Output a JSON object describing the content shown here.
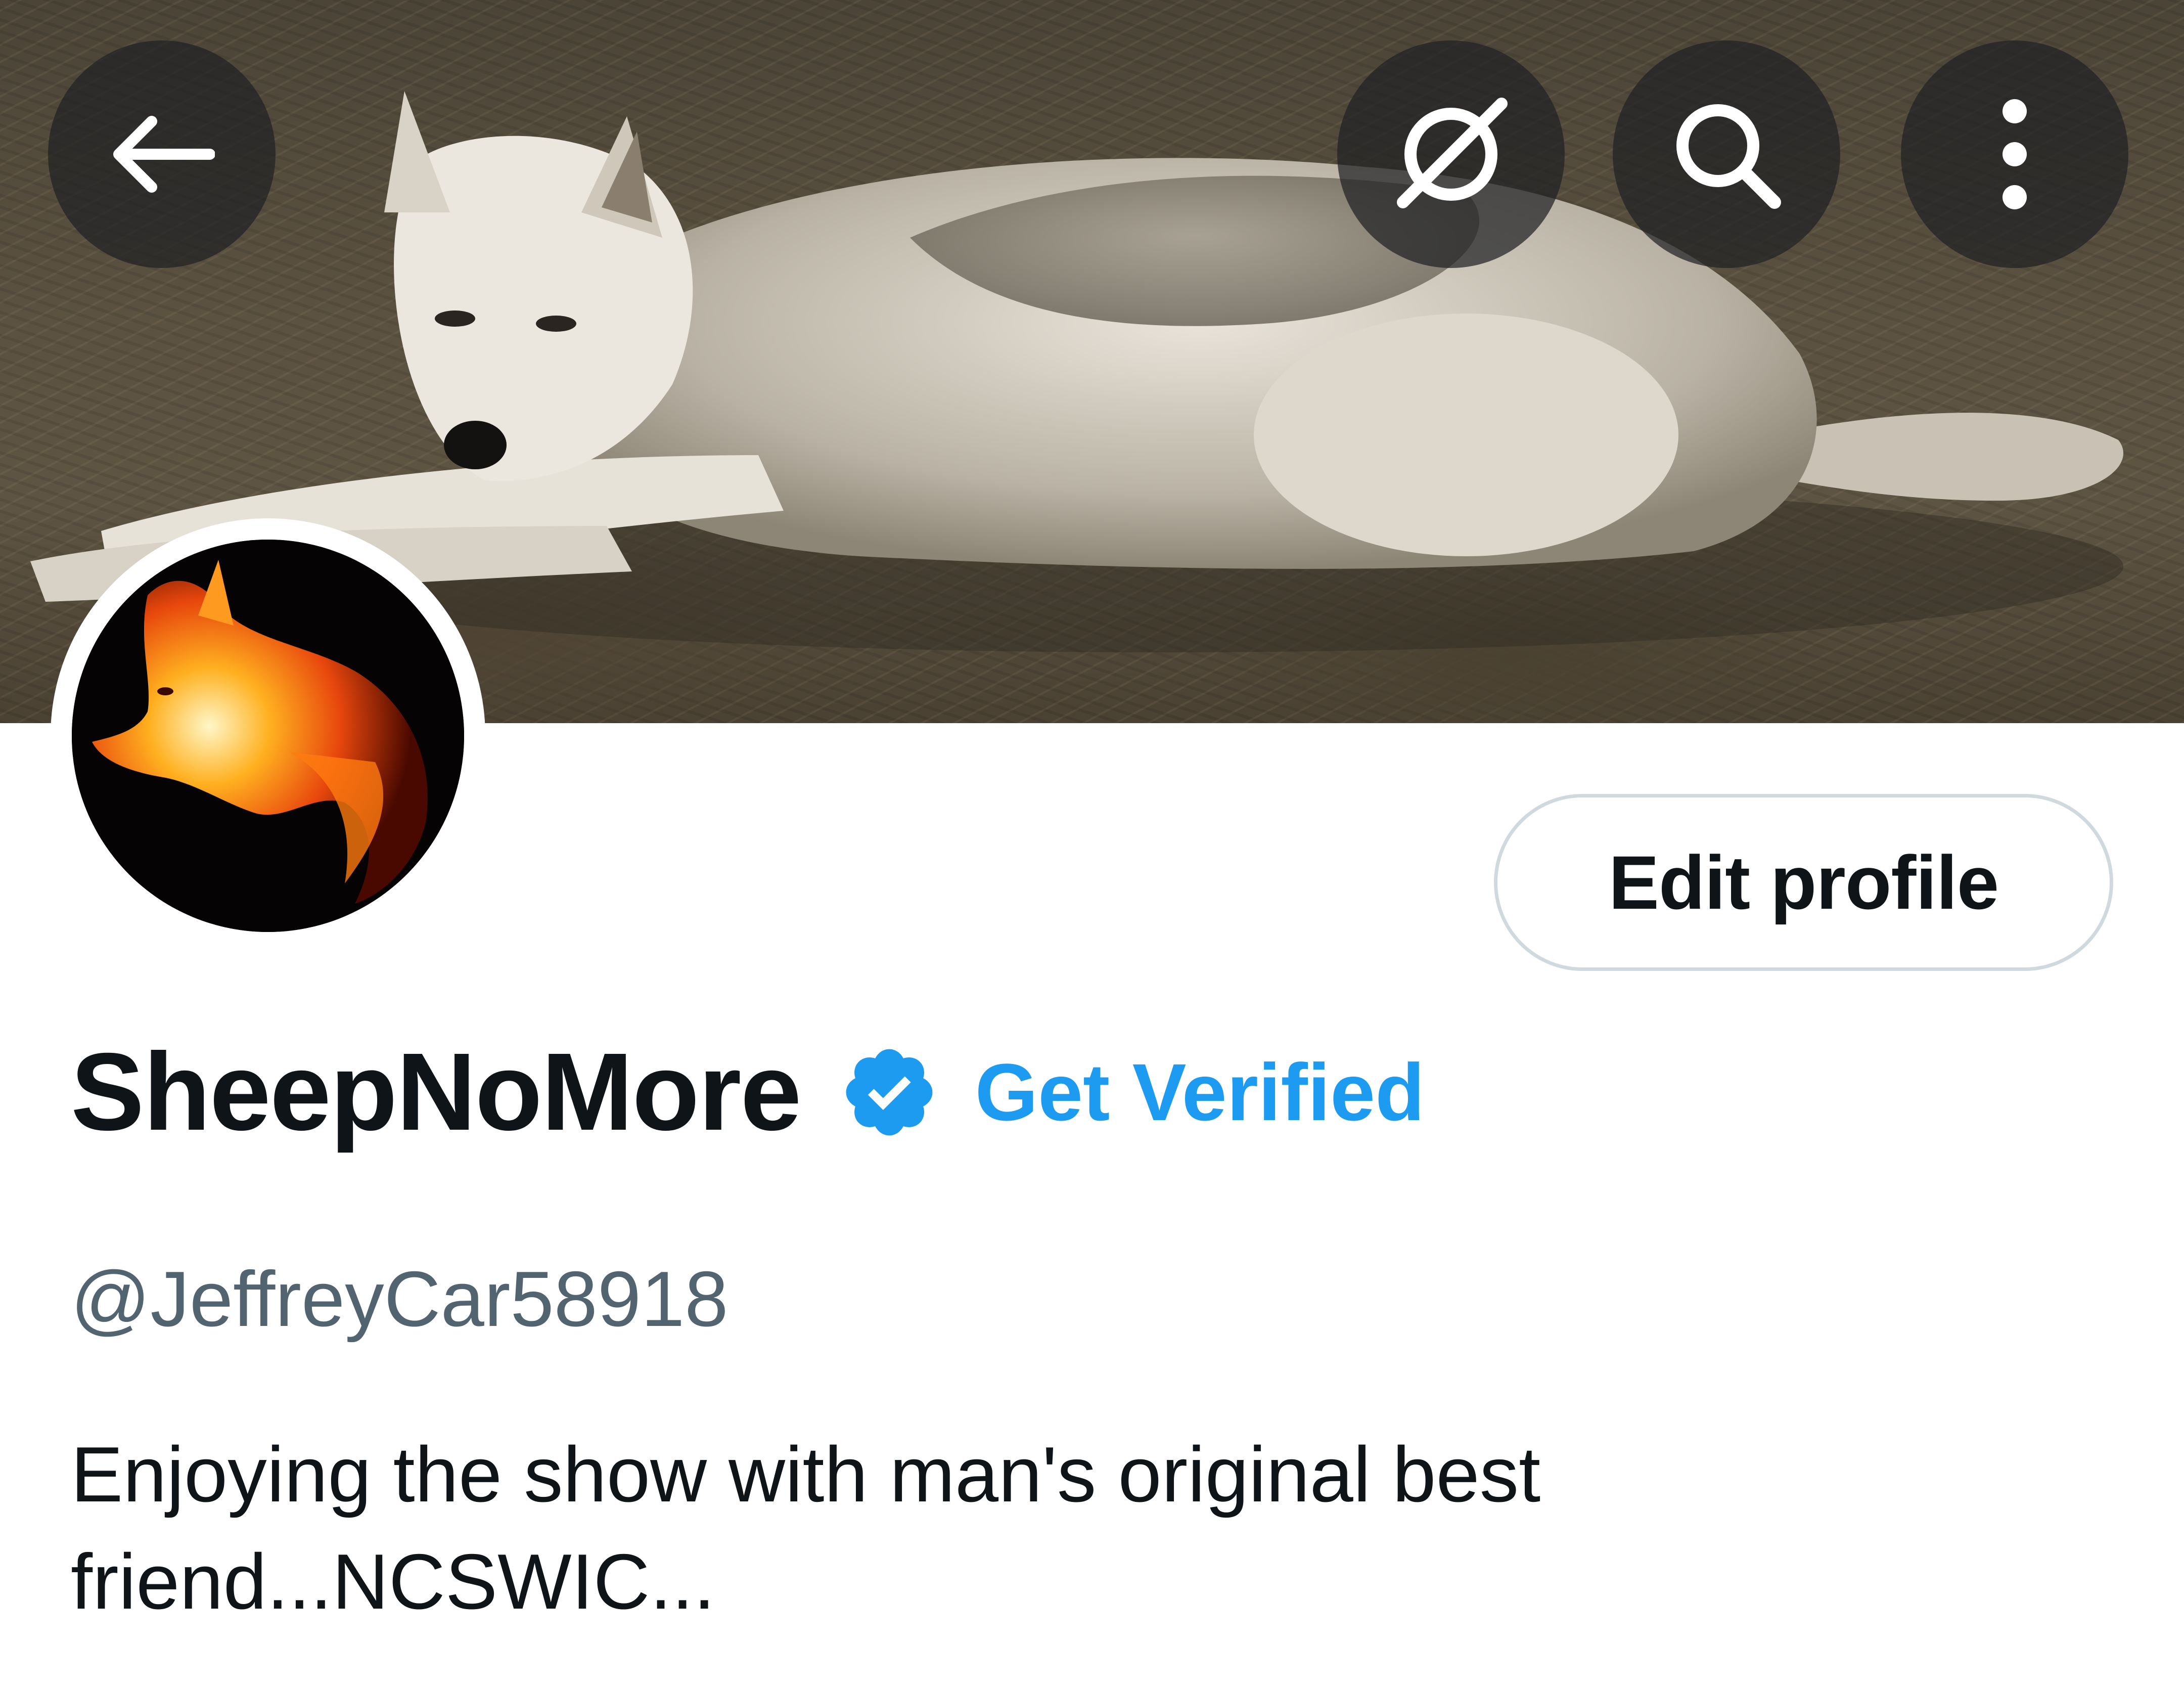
{
  "header": {
    "back_icon": "arrow-left-icon",
    "grok_icon": "grok-icon",
    "search_icon": "search-icon",
    "more_icon": "more-vertical-icon",
    "banner_image": "wolf lying on ground",
    "avatar_image": "fire wolf"
  },
  "profile": {
    "edit_label": "Edit profile",
    "display_name": "SheepNoMore",
    "get_verified_label": "Get Verified",
    "handle": "@JeffreyCar58918",
    "bio": "Enjoying the show with man's original best friend...NCSWIC..."
  },
  "colors": {
    "accent": "#1d9bf0",
    "text_primary": "#0f1419",
    "text_secondary": "#536471",
    "border": "#cfd9de"
  }
}
